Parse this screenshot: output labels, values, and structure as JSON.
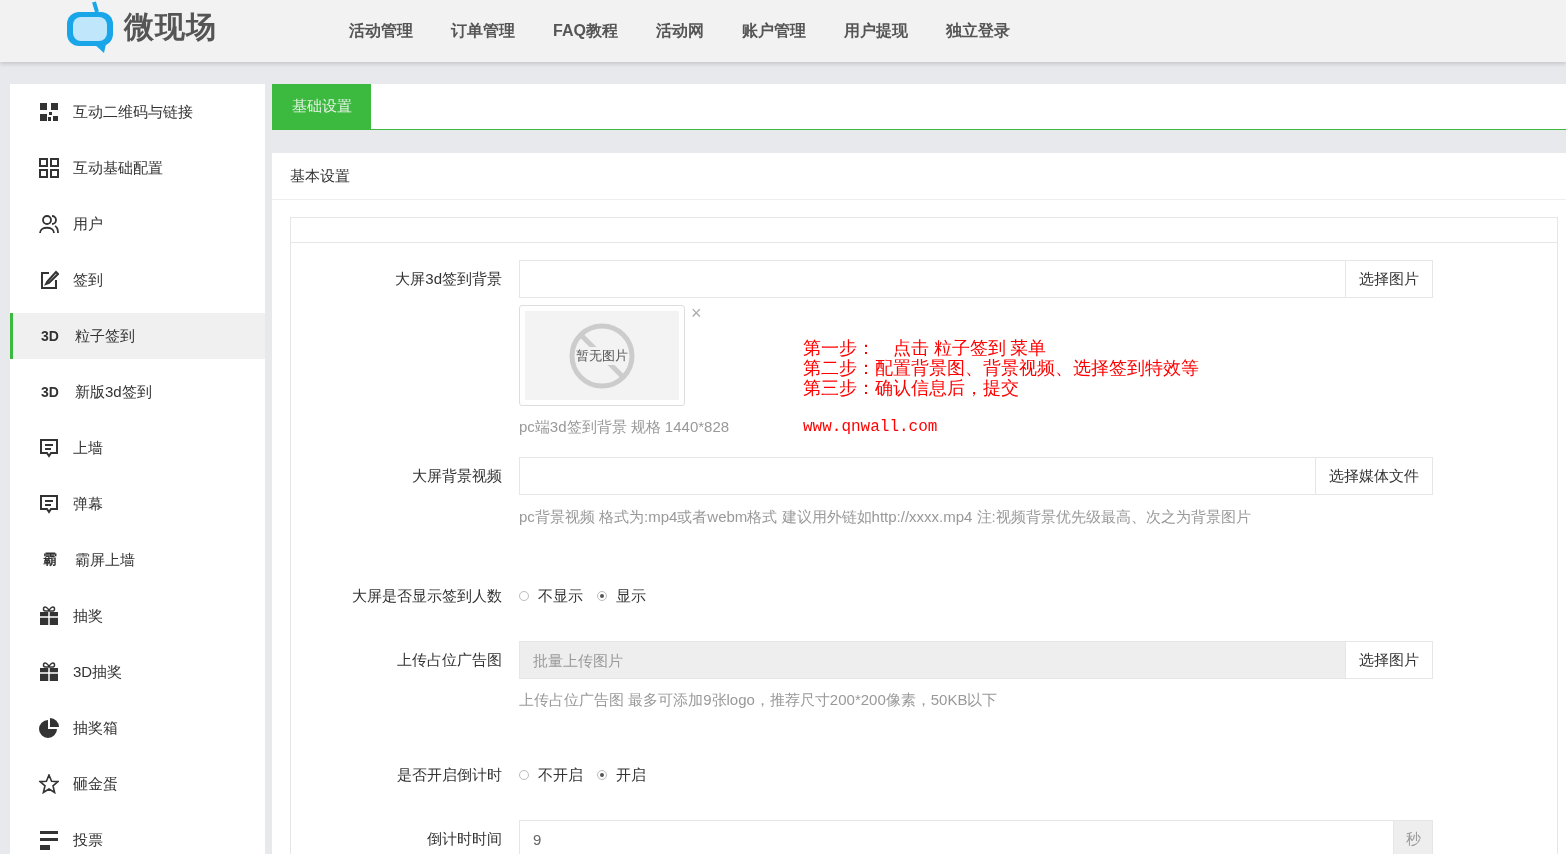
{
  "header": {
    "logo_text": "微现场",
    "nav": [
      "活动管理",
      "订单管理",
      "FAQ教程",
      "活动网",
      "账户管理",
      "用户提现",
      "独立登录"
    ]
  },
  "sidebar": {
    "items": [
      {
        "label": "互动二维码与链接",
        "selected": false
      },
      {
        "label": "互动基础配置",
        "selected": false
      },
      {
        "label": "用户",
        "selected": false
      },
      {
        "label": "签到",
        "selected": false
      },
      {
        "label": "粒子签到",
        "selected": true,
        "icon_text": "3D"
      },
      {
        "label": "新版3d签到",
        "selected": false,
        "icon_text": "3D"
      },
      {
        "label": "上墙",
        "selected": false
      },
      {
        "label": "弹幕",
        "selected": false
      },
      {
        "label": "霸屏上墙",
        "selected": false,
        "icon_text": "霸"
      },
      {
        "label": "抽奖",
        "selected": false
      },
      {
        "label": "3D抽奖",
        "selected": false
      },
      {
        "label": "抽奖箱",
        "selected": false
      },
      {
        "label": "砸金蛋",
        "selected": false
      },
      {
        "label": "投票",
        "selected": false
      }
    ]
  },
  "tabs": [
    {
      "label": "基础设置",
      "selected": true
    }
  ],
  "panel": {
    "title": "基本设置",
    "fields": [
      {
        "kind": "upload",
        "label": "大屏3d签到背景",
        "button": "选择图片",
        "preview": {
          "text": "暂无图片",
          "close": "×"
        },
        "help": "pc端3d签到背景 规格 1440*828",
        "notes": {
          "lines": [
            "第一步：　点击 粒子签到 菜单",
            "第二步：配置背景图、背景视频、选择签到特效等",
            "第三步：确认信息后，提交"
          ],
          "url": "www.qnwall.com"
        }
      },
      {
        "kind": "upload",
        "label": "大屏背景视频",
        "button": "选择媒体文件",
        "help": "pc背景视频 格式为:mp4或者webm格式 建议用外链如http://xxxx.mp4 注:视频背景优先级最高、次之为背景图片"
      },
      {
        "kind": "radio",
        "label": "大屏是否显示签到人数",
        "options": [
          {
            "label": "不显示",
            "selected": false
          },
          {
            "label": "显示",
            "selected": true
          }
        ]
      },
      {
        "kind": "upload",
        "label": "上传占位广告图",
        "button": "选择图片",
        "placeholder": "批量上传图片",
        "disabled": true,
        "help": "上传占位广告图 最多可添加9张logo，推荐尺寸200*200像素，50KB以下"
      },
      {
        "kind": "radio",
        "label": "是否开启倒计时",
        "options": [
          {
            "label": "不开启",
            "selected": false
          },
          {
            "label": "开启",
            "selected": true
          }
        ]
      },
      {
        "kind": "number",
        "label": "倒计时时间",
        "value": "9",
        "unit": "秒"
      }
    ]
  }
}
